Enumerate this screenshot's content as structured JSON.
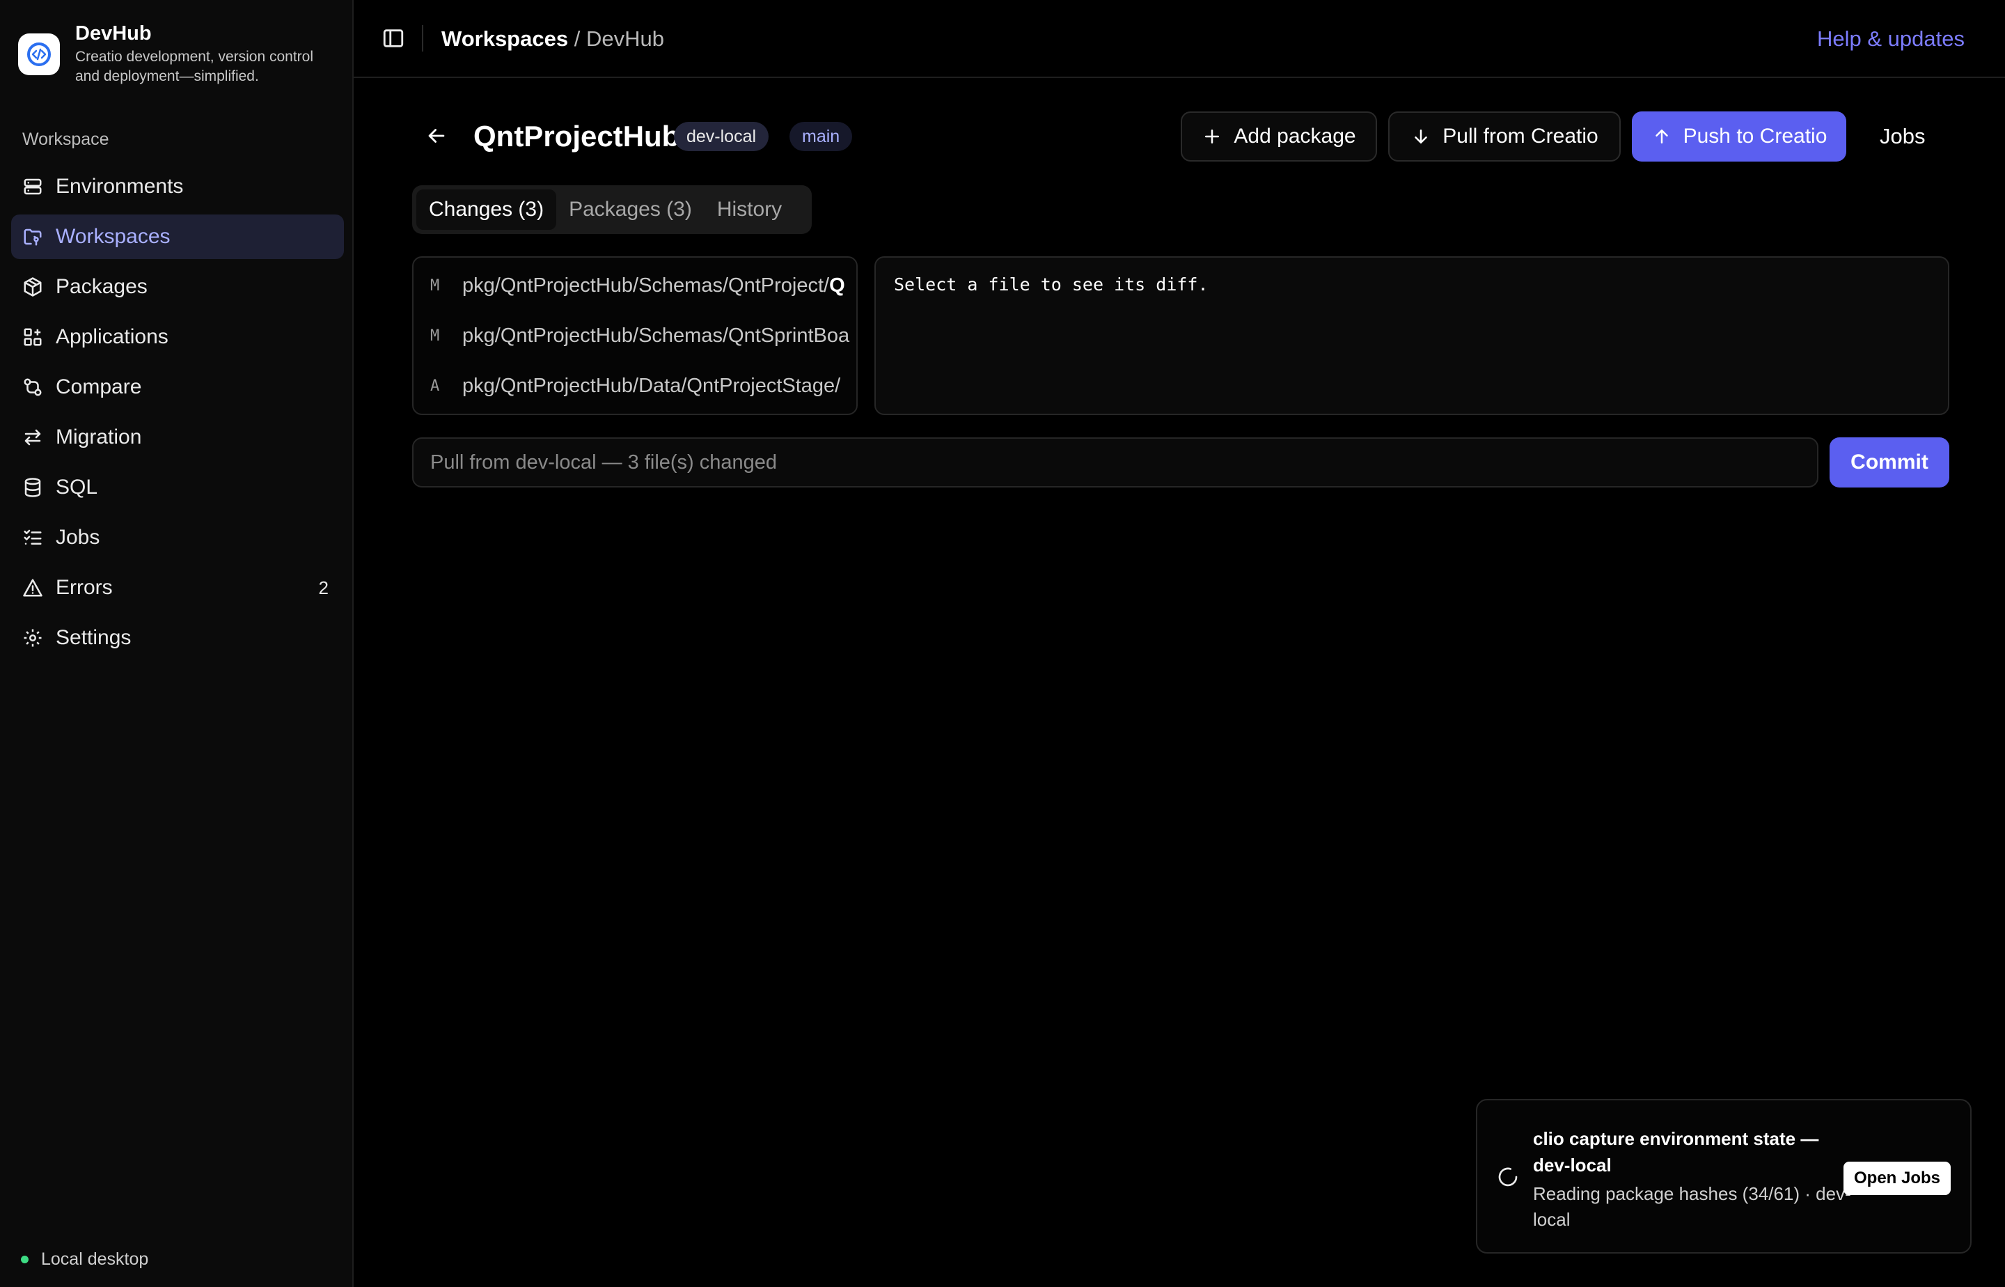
{
  "app": {
    "name": "DevHub",
    "tagline": "Creatio development, version control and deployment—simplified."
  },
  "sidebar": {
    "section_label": "Workspace",
    "items": [
      {
        "label": "Environments",
        "icon": "server-icon"
      },
      {
        "label": "Workspaces",
        "icon": "folder-git-icon",
        "active": true
      },
      {
        "label": "Packages",
        "icon": "package-icon"
      },
      {
        "label": "Applications",
        "icon": "grid-plus-icon"
      },
      {
        "label": "Compare",
        "icon": "git-compare-icon"
      },
      {
        "label": "Migration",
        "icon": "arrows-swap-icon"
      },
      {
        "label": "SQL",
        "icon": "database-icon"
      },
      {
        "label": "Jobs",
        "icon": "checklist-icon"
      },
      {
        "label": "Errors",
        "icon": "warning-icon",
        "badge": "2"
      },
      {
        "label": "Settings",
        "icon": "gear-icon"
      }
    ],
    "status": "Local desktop",
    "status_color": "#3ddc84"
  },
  "topbar": {
    "breadcrumb_root": "Workspaces",
    "breadcrumb_sep": "/",
    "breadcrumb_current": "DevHub",
    "help_link": "Help & updates"
  },
  "workspace": {
    "title": "QntProjectHub",
    "environment": "dev-local",
    "branch": "main",
    "actions": {
      "add_package": "Add package",
      "pull": "Pull from Creatio",
      "push": "Push to Creatio",
      "jobs": "Jobs"
    },
    "tabs": [
      "Changes (3)",
      "Packages (3)",
      "History"
    ],
    "active_tab": 0,
    "changes": [
      {
        "status": "M",
        "path_prefix": "pkg/QntProjectHub/Schemas/QntProject/",
        "path_tail": "Q"
      },
      {
        "status": "M",
        "path_prefix": "pkg/QntProjectHub/Schemas/QntSprintBoa",
        "path_tail": ""
      },
      {
        "status": "A",
        "path_prefix": "pkg/QntProjectHub/Data/QntProjectStage/",
        "path_tail": ""
      }
    ],
    "diff_placeholder": "Select a file to see its diff.",
    "commit_placeholder": "Pull from dev-local — 3 file(s) changed",
    "commit_button": "Commit"
  },
  "toast": {
    "title": "clio capture environment state — dev-local",
    "body": "Reading package hashes (34/61) · dev-local",
    "button": "Open Jobs"
  },
  "colors": {
    "accent": "#5b5ff0",
    "link": "#7c7cff",
    "active_nav_bg": "#1e2034",
    "active_nav_text": "#a9b0ff"
  }
}
